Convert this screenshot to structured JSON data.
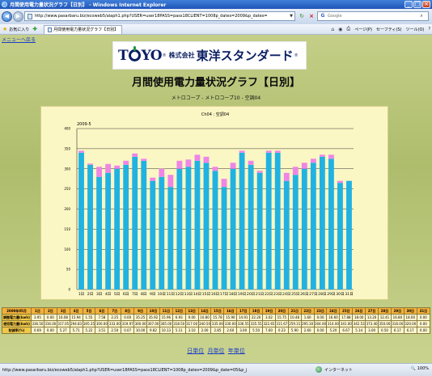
{
  "browser": {
    "title": "月間使用電力量状況グラフ【日別】 - Windows Internet Explorer",
    "address": "http://www.pasarbaru.biz/ecoweb5/alaph1.php?USER=user18PASS=pass18CLIENT=1008p_dates=2009&p_dates=",
    "search_placeholder": "Google",
    "favorites_label": "お気に入り",
    "tab_label": "月間使用電力量状況グラフ【日別】",
    "tools": {
      "page": "ページ(P)",
      "safety": "セーフティ(S)",
      "tools": "ツール(O)",
      "help": "?"
    },
    "status_url": "http://www.pasarbaru.biz/ecoweb5/alaph1.php?USER=user18PASS=pass18CLIENT=1008p_dates=2009&p_date=05&p_j",
    "zone": "インターネット",
    "zoom": "100%"
  },
  "page": {
    "back_link": "メニューへ戻る",
    "logo_text": "TOYO",
    "company_prefix": "株式会社",
    "company_name": "東洋スタンダード",
    "title": "月間使用電力量状況グラフ【日別】",
    "subtitle": "メトロコープ - メトロコープ10 - 空調04",
    "units": {
      "day": "日単位",
      "month": "月単位",
      "year": "年単位"
    }
  },
  "chart_data": {
    "type": "bar",
    "title": "Ch04 : 空調04",
    "period": "2009-5",
    "categories": [
      "1日",
      "2日",
      "3日",
      "4日",
      "5日",
      "6日",
      "7日",
      "8日",
      "9日",
      "10日",
      "11日",
      "12日",
      "13日",
      "14日",
      "15日",
      "16日",
      "17日",
      "18日",
      "19日",
      "20日",
      "21日",
      "22日",
      "23日",
      "24日",
      "25日",
      "26日",
      "27日",
      "28日",
      "29日",
      "30日",
      "31日"
    ],
    "series": [
      {
        "name": "",
        "color": "#21b2e2",
        "values": [
          340,
          310,
          280,
          290,
          300,
          310,
          330,
          320,
          270,
          280,
          255,
          300,
          305,
          320,
          315,
          295,
          255,
          300,
          340,
          310,
          290,
          340,
          340,
          270,
          285,
          300,
          315,
          330,
          325,
          265,
          270
        ]
      },
      {
        "name": "",
        "color": "#ee86e6",
        "values": [
          5,
          3,
          25,
          22,
          8,
          10,
          8,
          5,
          8,
          20,
          30,
          20,
          18,
          15,
          15,
          10,
          20,
          15,
          5,
          10,
          5,
          5,
          5,
          20,
          20,
          15,
          10,
          5,
          10,
          5,
          0
        ]
      }
    ],
    "ylim": [
      0,
      400
    ],
    "yticks": [
      "0",
      "50",
      "100",
      "150",
      "200",
      "250",
      "300",
      "350",
      "400"
    ],
    "grid": true
  },
  "table": {
    "header_label": "2009年05月",
    "days": [
      "1日",
      "2日",
      "3日",
      "4日",
      "5日",
      "6日",
      "7日",
      "8日",
      "9日",
      "10日",
      "11日",
      "12日",
      "13日",
      "14日",
      "15日",
      "16日",
      "17日",
      "18日",
      "19日",
      "20日",
      "21日",
      "22日",
      "23日",
      "24日",
      "25日",
      "26日",
      "27日",
      "28日",
      "29日",
      "30日",
      "31日"
    ],
    "rows": [
      {
        "label": "調整電力量(kwh)",
        "cells": [
          "3.95",
          "0.00",
          "16.08",
          "15.94",
          "1.55",
          "7.58",
          "2.25",
          "0.00",
          "35.25",
          "35.92",
          "15.96",
          "6.93",
          "9.00",
          "10.80",
          "15.78",
          "15.90",
          "14.91",
          "22.20",
          "3.02",
          "15.75",
          "10.48",
          "1.60",
          "0.00",
          "16.60",
          "17.88",
          "18.00",
          "13.20",
          "12.41",
          "16.80",
          "18.00",
          "0.00"
        ]
      },
      {
        "label": "使用電力量(kwh)",
        "cells": [
          "336.50",
          "316.00",
          "317.05",
          "294.83",
          "305.35",
          "300.00",
          "333.00",
          "319.97",
          "300.00",
          "307.00",
          "305.00",
          "318.50",
          "317.00",
          "340.50",
          "335.00",
          "330.00",
          "336.55",
          "335.55",
          "322.65",
          "311.67",
          "259.31",
          "295.30",
          "304.00",
          "314.00",
          "341.00",
          "342.53",
          "373.40",
          "350.00",
          "316.00",
          "320.00",
          "0.00"
        ]
      },
      {
        "label": "削減率(%)",
        "cells": [
          "0.69",
          "0.00",
          "5.27",
          "5.71",
          "5.22",
          "3.51",
          "2.50",
          "0.07",
          "10.00",
          "9.82",
          "10.13",
          "5.11",
          "3.10",
          "2.00",
          "2.85",
          "2.60",
          "3.00",
          "5.50",
          "7.60",
          "0.23",
          "5.90",
          "2.60",
          "0.00",
          "5.20",
          "6.67",
          "5.14",
          "3.00",
          "0.50",
          "6.17",
          "6.17",
          "0.00"
        ]
      }
    ]
  }
}
